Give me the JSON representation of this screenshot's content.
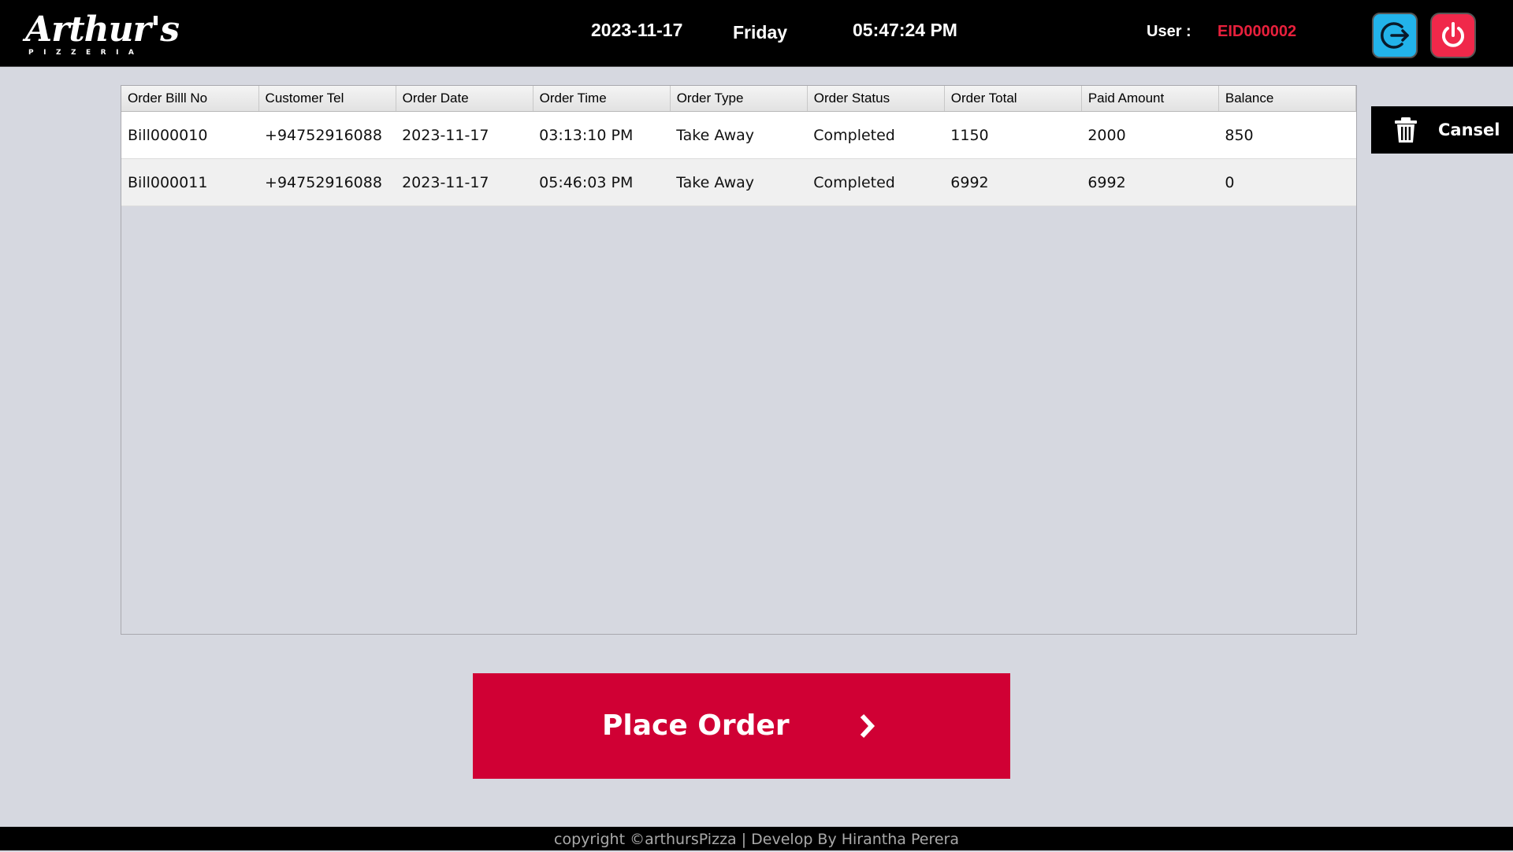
{
  "header": {
    "logo_text": "Arthur's",
    "logo_subtext": "PIZZERIA",
    "date": "2023-11-17",
    "day": "Friday",
    "time": "05:47:24 PM",
    "user_label": "User :",
    "user_id": "EID000002",
    "logout_icon": "logout-icon",
    "power_icon": "power-icon"
  },
  "colors": {
    "topbar": "#000000",
    "background": "#d6d8e0",
    "user_id": "#e8203c",
    "logout_button": "#22b3ea",
    "power_button": "#f0284a",
    "place_order": "#d00034"
  },
  "orders_table": {
    "columns": [
      "Order Billl No",
      "Customer Tel",
      "Order Date",
      "Order Time",
      "Order Type",
      "Order Status",
      "Order Total",
      "Paid Amount",
      "Balance"
    ],
    "rows": [
      [
        "Bill000010",
        "+94752916088",
        "2023-11-17",
        "03:13:10 PM",
        "Take Away",
        "Completed",
        "1150",
        "2000",
        "850"
      ],
      [
        "Bill000011",
        "+94752916088",
        "2023-11-17",
        "05:46:03 PM",
        "Take Away",
        "Completed",
        "6992",
        "6992",
        "0"
      ]
    ]
  },
  "cancel_button": {
    "label": "Cansel",
    "icon": "trash-icon"
  },
  "place_order_button": {
    "label": "Place Order",
    "icon": "chevron-right-icon"
  },
  "footer": {
    "text": "copyright ©arthursPizza | Develop By Hirantha Perera"
  }
}
